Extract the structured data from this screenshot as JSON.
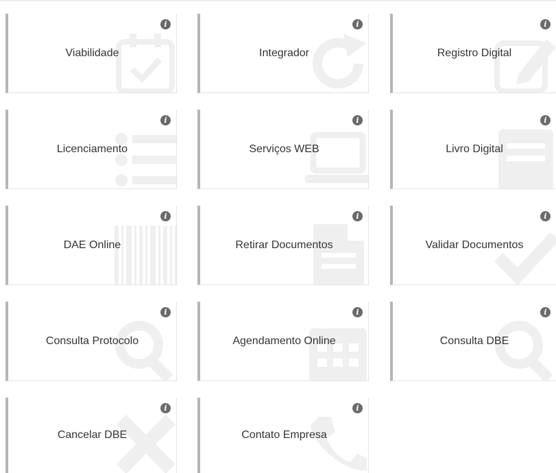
{
  "services": [
    {
      "label": "Viabilidade",
      "info": "i",
      "icon": "calendar-check-icon"
    },
    {
      "label": "Integrador",
      "info": "i",
      "icon": "refresh-icon"
    },
    {
      "label": "Registro Digital",
      "info": "i",
      "icon": "edit-icon"
    },
    {
      "label": "Licenciamento",
      "info": "i",
      "icon": "list-icon"
    },
    {
      "label": "Serviços WEB",
      "info": "i",
      "icon": "laptop-icon"
    },
    {
      "label": "Livro Digital",
      "info": "i",
      "icon": "book-icon"
    },
    {
      "label": "DAE Online",
      "info": "i",
      "icon": "barcode-icon"
    },
    {
      "label": "Retirar Documentos",
      "info": "i",
      "icon": "file-icon"
    },
    {
      "label": "Validar Documentos",
      "info": "i",
      "icon": "check-icon"
    },
    {
      "label": "Consulta Protocolo",
      "info": "i",
      "icon": "search-icon"
    },
    {
      "label": "Agendamento Online",
      "info": "i",
      "icon": "calendar-icon"
    },
    {
      "label": "Consulta DBE",
      "info": "i",
      "icon": "search-icon"
    },
    {
      "label": "Cancelar DBE",
      "info": "i",
      "icon": "close-icon"
    },
    {
      "label": "Contato Empresa",
      "info": "i",
      "icon": "phone-icon"
    }
  ],
  "colors": {
    "card_border": "#b5b5b5",
    "text": "#333333",
    "info_icon": "#6a6a6a"
  }
}
